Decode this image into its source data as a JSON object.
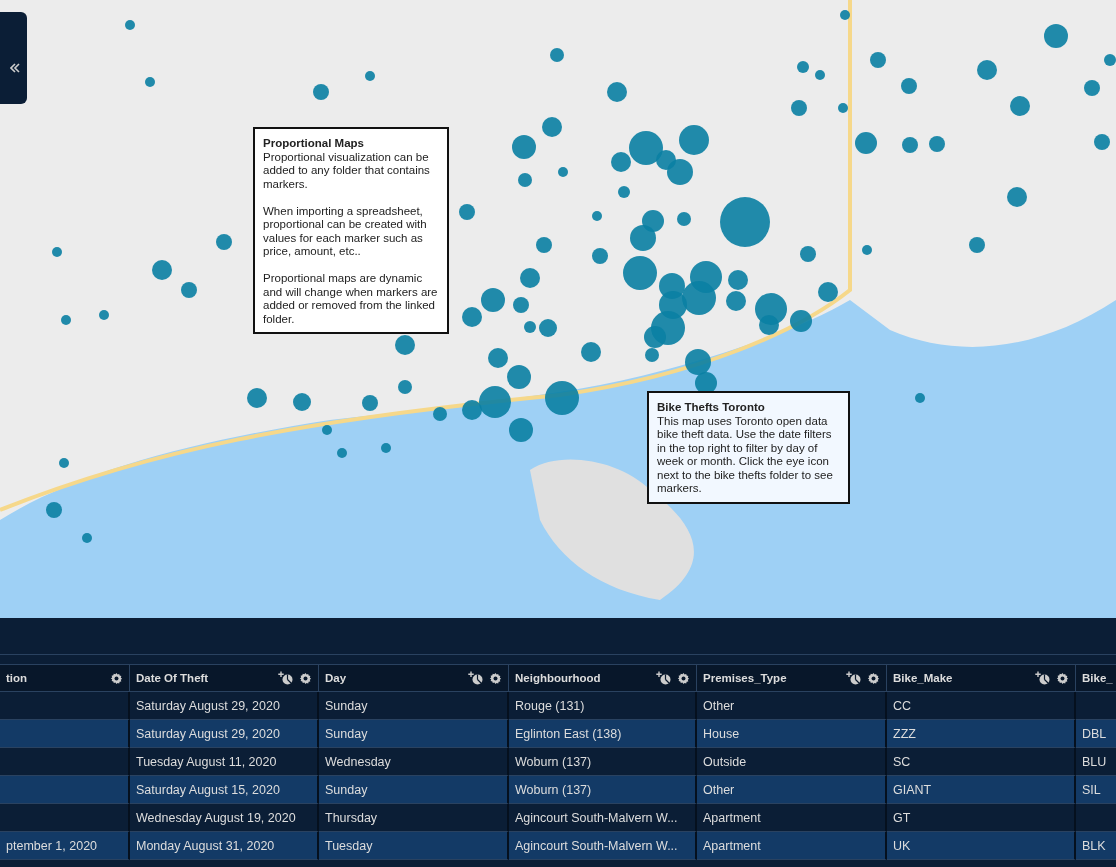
{
  "map": {
    "notes": [
      {
        "title": "Proportional Maps",
        "paragraphs": [
          "Proportional visualization can be added to any folder that contains markers.",
          "When importing a spreadsheet, proportional can be created with values for each marker such as price, amount, etc..",
          "Proportional maps are dynamic and will change when markers are added or removed from the linked folder."
        ]
      },
      {
        "title": "Bike Thefts Toronto",
        "paragraphs": [
          "This map uses Toronto open data bike theft data. Use the date filters in the top right to filter by day of week or month. Click the eye icon next to the bike thefts folder to see markers."
        ]
      }
    ]
  },
  "table": {
    "columns": [
      {
        "label": "tion",
        "chart_icon": false
      },
      {
        "label": "Date Of Theft",
        "chart_icon": true
      },
      {
        "label": "Day",
        "chart_icon": true
      },
      {
        "label": "Neighbourhood",
        "chart_icon": true
      },
      {
        "label": "Premises_Type",
        "chart_icon": true
      },
      {
        "label": "Bike_Make",
        "chart_icon": true
      },
      {
        "label": "Bike_",
        "chart_icon": false
      }
    ],
    "rows": [
      [
        "",
        "Saturday August 29, 2020",
        "Sunday",
        "Rouge (131)",
        "Other",
        "CC",
        ""
      ],
      [
        "",
        "Saturday August 29, 2020",
        "Sunday",
        "Eglinton East (138)",
        "House",
        "ZZZ",
        "DBL"
      ],
      [
        "",
        "Tuesday August 11, 2020",
        "Wednesday",
        "Woburn (137)",
        "Outside",
        "SC",
        "BLU"
      ],
      [
        "",
        "Saturday August 15, 2020",
        "Sunday",
        "Woburn (137)",
        "Other",
        "GIANT",
        "SIL"
      ],
      [
        "",
        "Wednesday August 19, 2020",
        "Thursday",
        "Agincourt South-Malvern W...",
        "Apartment",
        "GT",
        ""
      ],
      [
        "ptember 1, 2020",
        "Monday August 31, 2020",
        "Tuesday",
        "Agincourt South-Malvern W...",
        "Apartment",
        "UK",
        "BLK"
      ]
    ]
  }
}
